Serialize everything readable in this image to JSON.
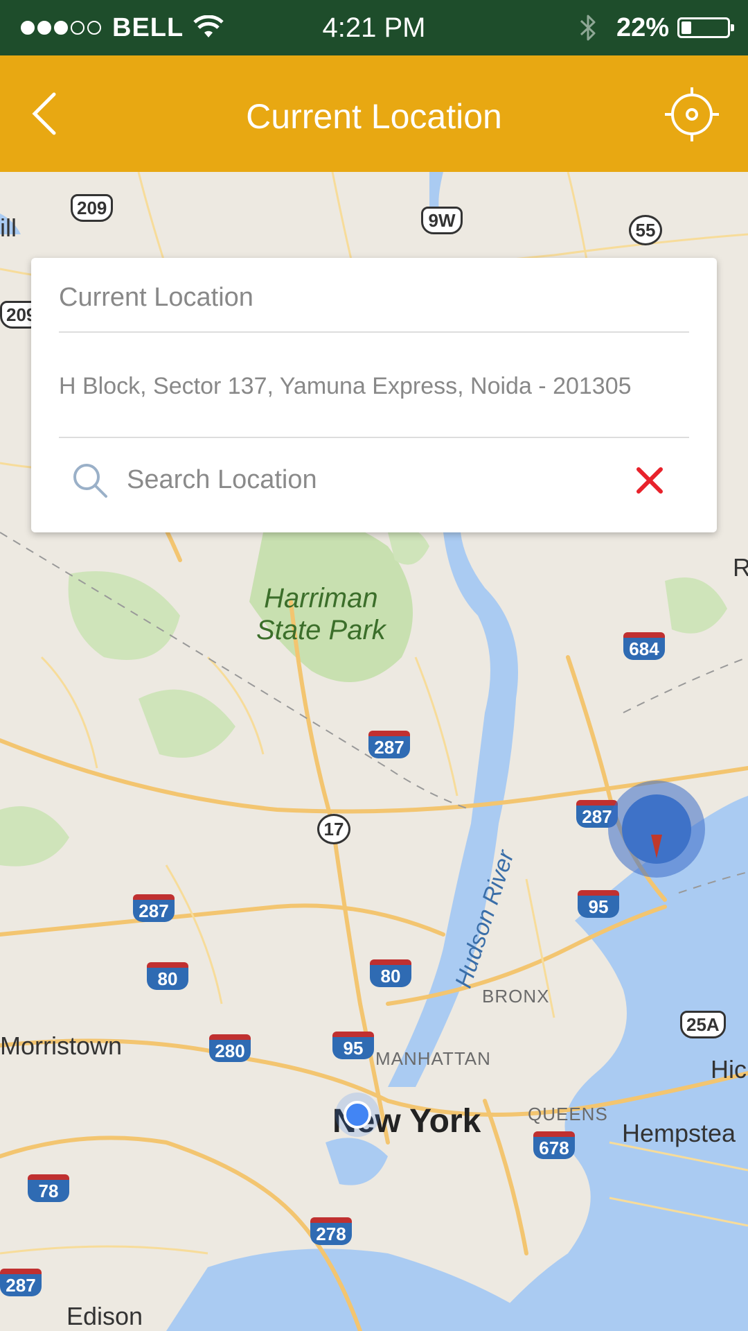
{
  "status_bar": {
    "carrier": "BELL",
    "time": "4:21 PM",
    "battery_percent": "22%",
    "battery_level": 0.22,
    "signal_bars_filled": 3,
    "signal_bars_total": 5
  },
  "header": {
    "title": "Current Location",
    "back_icon": "chevron-left-icon",
    "locate_icon": "crosshair-target-icon",
    "background_color": "#e8a812"
  },
  "location_card": {
    "label": "Current Location",
    "address": "H Block, Sector 137, Yamuna Express, Noida - 201305",
    "search": {
      "placeholder": "Search Location",
      "value": ""
    },
    "clear_icon": "close-x-icon",
    "clear_color": "#e8222b"
  },
  "map": {
    "park_label_line1": "Harriman",
    "park_label_line2": "State Park",
    "river_label": "Hudson River",
    "cities": {
      "new_york": "New York",
      "morristown": "Morristown",
      "hempstead": "Hempstea",
      "edison": "Edison",
      "hicksville": "Hic",
      "fragment_left": "ill",
      "fragment_right": "R"
    },
    "neighborhoods": {
      "bronx": "BRONX",
      "manhattan": "MANHATTAN",
      "queens": "QUEENS"
    },
    "shields": {
      "us209_top": "209",
      "us9w": "9W",
      "s55": "55",
      "us209_left": "209",
      "i684": "684",
      "i287_mid": "287",
      "i287_right": "287",
      "s17": "17",
      "i287_left": "287",
      "i80_left": "80",
      "i80_mid": "80",
      "i95_right": "95",
      "i95_mid": "95",
      "i280": "280",
      "s25a": "25A",
      "i678": "678",
      "i78": "78",
      "i278": "278",
      "i287_bottom": "287"
    }
  }
}
